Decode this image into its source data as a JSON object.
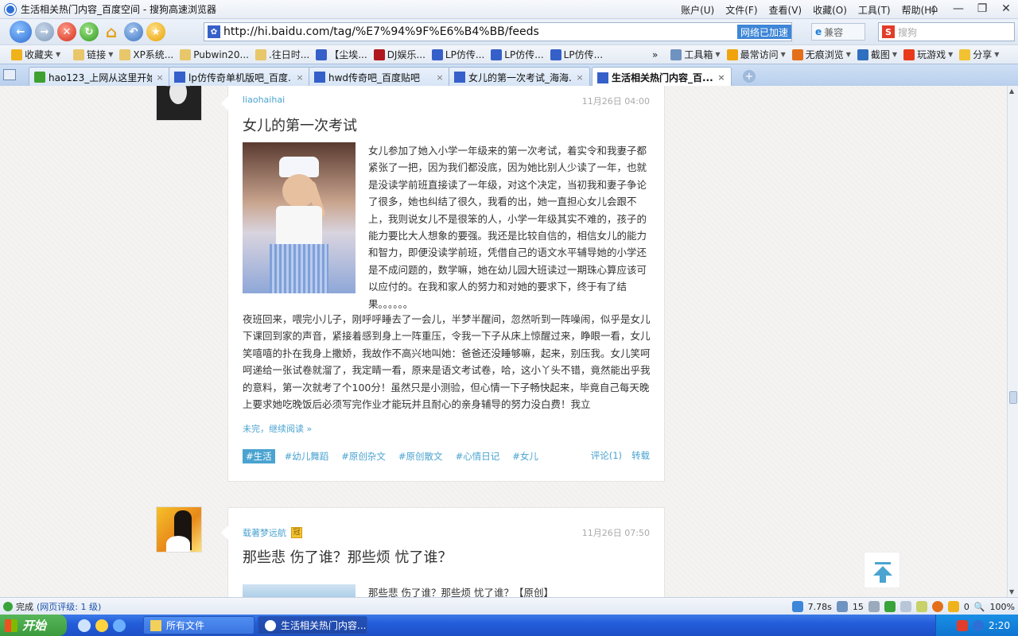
{
  "window": {
    "title": "生活相关热门内容_百度空间 - 搜狗高速浏览器",
    "menus": [
      "账户(U)",
      "文件(F)",
      "查看(V)",
      "收藏(O)",
      "工具(T)",
      "帮助(H)"
    ]
  },
  "address": {
    "url": "http://hi.baidu.com/tag/%E7%94%9F%E6%B4%BB/feeds",
    "accel_label": "网络已加速",
    "compat_label": "兼容",
    "search_placeholder": "搜狗"
  },
  "bookmarks": {
    "left": [
      "收藏夹",
      "链接",
      "XP系统...",
      "Pubwin20...",
      ".往日时...",
      "【尘埃...",
      "DJ娱乐...",
      "LP仿传...",
      "LP仿传...",
      "LP仿传..."
    ],
    "right": [
      "工具箱",
      "最常访问",
      "无痕浏览",
      "截图",
      "玩游戏",
      "分享"
    ]
  },
  "tabs": [
    {
      "label": "hao123_上网从这里开始"
    },
    {
      "label": "lp仿传奇单机版吧_百度..."
    },
    {
      "label": "hwd传奇吧_百度贴吧"
    },
    {
      "label": "女儿的第一次考试_海海..."
    },
    {
      "label": "生活相关热门内容_百..."
    }
  ],
  "post1": {
    "author": "liaohaihai",
    "time": "11月26日 04:00",
    "title": "女儿的第一次考试",
    "paragraph_side": "女儿参加了她入小学一年级来的第一次考试，着实令和我妻子都紧张了一把，因为我们都没底，因为她比别人少读了一年，也就是没读学前班直接读了一年级，对这个决定，当初我和妻子争论了很多，她也纠结了很久，我看的出，她一直担心女儿会跟不上，我则说女儿不是很笨的人，小学一年级其实不难的，孩子的能力要比大人想象的要强。我还是比较自信的，相信女儿的能力和智力，即便没读学前班，凭借自己的语文水平辅导她的小学还是不成问题的，数学嘛，她在幼儿园大班读过一期珠心算应该可以应付的。在我和家人的努力和对她的要求下，终于有了结果。。。。。。",
    "paragraph_full": "夜班回来，喂完小儿子，刚呼呼睡去了一会儿，半梦半醒间，忽然听到一阵噪闹，似乎是女儿下课回到家的声音，紧接着感到身上一阵重压，令我一下子从床上惊醒过来，睁眼一看，女儿笑嘻嘻的扑在我身上撒娇，我故作不高兴地叫她：爸爸还没睡够嘛，起来，别压我。女儿笑呵呵递给一张试卷就溜了，我定睛一看，原来是语文考试卷，哈，这小丫头不错，竟然能出乎我的意料，第一次就考了个100分！虽然只是小测验，但心情一下子畅快起来，毕竟自己每天晚上要求她吃晚饭后必须写完作业才能玩并且耐心的亲身辅导的努力没白费！我立",
    "read_more": "未完，继续阅读 »",
    "tags": [
      "#生活",
      "#幼儿舞蹈",
      "#原创杂文",
      "#原创散文",
      "#心情日记",
      "#女儿"
    ],
    "comment": "评论(1)",
    "repost": "转载"
  },
  "post2": {
    "author": "载著梦远航",
    "vip_badge": "冠",
    "time": "11月26日 07:50",
    "title": "那些悲 伤了谁？那些烦 忧了谁？",
    "excerpt": "那些悲 伤了谁？那些烦 忧了谁？【原创】"
  },
  "status": {
    "text": "完成",
    "rating": "(网页评级: 1 级)",
    "load_time": "7.78s",
    "count": "15",
    "shield_count": "0",
    "zoom": "100%"
  },
  "taskbar": {
    "start": "开始",
    "items": [
      "所有文件",
      "生活相关热门内容..."
    ],
    "clock": "2:20"
  }
}
